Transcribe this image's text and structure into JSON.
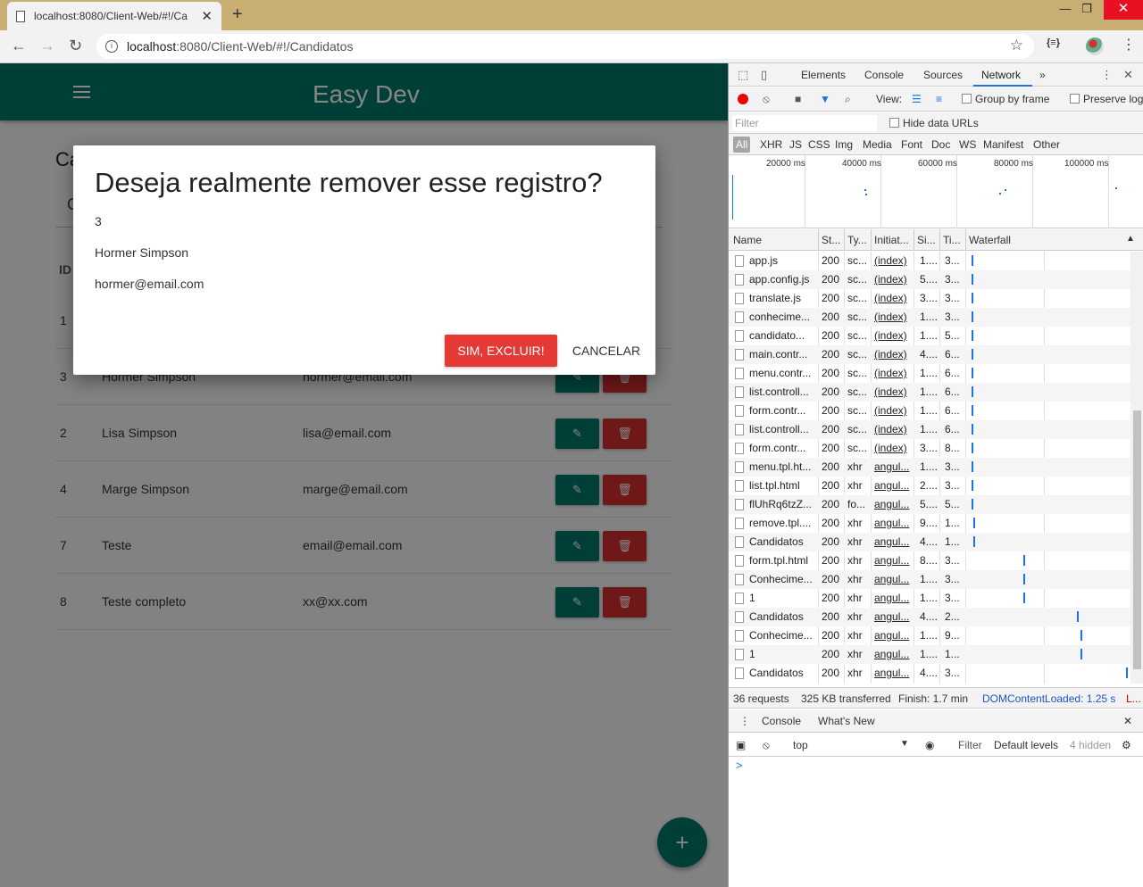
{
  "browser": {
    "tab_title": "localhost:8080/Client-Web/#!/Ca",
    "url_host": "localhost",
    "url_path": ":8080/Client-Web/#!/Candidatos",
    "new_tab": "+",
    "minimize": "—",
    "restore": "❐",
    "close": "✕",
    "ext_label": "{≡}"
  },
  "app": {
    "title": "Easy Dev",
    "page_title": "Ca",
    "search_label": "C",
    "col_id": "ID",
    "rows": [
      {
        "id": "1",
        "name": "",
        "email": ""
      },
      {
        "id": "3",
        "name": "Hormer Simpson",
        "email": "hormer@email.com"
      },
      {
        "id": "2",
        "name": "Lisa Simpson",
        "email": "lisa@email.com"
      },
      {
        "id": "4",
        "name": "Marge Simpson",
        "email": "marge@email.com"
      },
      {
        "id": "7",
        "name": "Teste",
        "email": "email@email.com"
      },
      {
        "id": "8",
        "name": "Teste completo",
        "email": "xx@xx.com"
      }
    ],
    "edit_icon": "✎",
    "delete_icon": "🗑",
    "fab": "+"
  },
  "dialog": {
    "title": "Deseja realmente remover esse registro?",
    "id": "3",
    "name": "Hormer Simpson",
    "email": "hormer@email.com",
    "confirm": "SIM, EXCLUIR!",
    "cancel": "CANCELAR"
  },
  "devtools": {
    "tabs": [
      "Elements",
      "Console",
      "Sources",
      "Network"
    ],
    "more": "»",
    "view_label": "View:",
    "group_by_frame": "Group by frame",
    "preserve_log": "Preserve log",
    "filter_placeholder": "Filter",
    "hide_data_urls": "Hide data URLs",
    "types": [
      "All",
      "XHR",
      "JS",
      "CSS",
      "Img",
      "Media",
      "Font",
      "Doc",
      "WS",
      "Manifest",
      "Other"
    ],
    "ticks": [
      "20000 ms",
      "40000 ms",
      "60000 ms",
      "80000 ms",
      "100000 ms"
    ],
    "columns": [
      "Name",
      "St...",
      "Ty...",
      "Initiat...",
      "Si...",
      "Ti...",
      "Waterfall"
    ],
    "rows": [
      {
        "name": "app.js",
        "status": "200",
        "type": "sc...",
        "initiator": "(index)",
        "size": "1....",
        "time": "3...",
        "wf": 0.01
      },
      {
        "name": "app.config.js",
        "status": "200",
        "type": "sc...",
        "initiator": "(index)",
        "size": "5....",
        "time": "3...",
        "wf": 0.01
      },
      {
        "name": "translate.js",
        "status": "200",
        "type": "sc...",
        "initiator": "(index)",
        "size": "3....",
        "time": "3...",
        "wf": 0.01
      },
      {
        "name": "conhecime...",
        "status": "200",
        "type": "sc...",
        "initiator": "(index)",
        "size": "1....",
        "time": "3...",
        "wf": 0.01
      },
      {
        "name": "candidato...",
        "status": "200",
        "type": "sc...",
        "initiator": "(index)",
        "size": "1....",
        "time": "5...",
        "wf": 0.01
      },
      {
        "name": "main.contr...",
        "status": "200",
        "type": "sc...",
        "initiator": "(index)",
        "size": "4....",
        "time": "6...",
        "wf": 0.01
      },
      {
        "name": "menu.contr...",
        "status": "200",
        "type": "sc...",
        "initiator": "(index)",
        "size": "1....",
        "time": "6...",
        "wf": 0.01
      },
      {
        "name": "list.controll...",
        "status": "200",
        "type": "sc...",
        "initiator": "(index)",
        "size": "1....",
        "time": "6...",
        "wf": 0.01
      },
      {
        "name": "form.contr...",
        "status": "200",
        "type": "sc...",
        "initiator": "(index)",
        "size": "1....",
        "time": "6...",
        "wf": 0.01
      },
      {
        "name": "list.controll...",
        "status": "200",
        "type": "sc...",
        "initiator": "(index)",
        "size": "1....",
        "time": "6...",
        "wf": 0.01
      },
      {
        "name": "form.contr...",
        "status": "200",
        "type": "sc...",
        "initiator": "(index)",
        "size": "3....",
        "time": "8...",
        "wf": 0.01
      },
      {
        "name": "menu.tpl.ht...",
        "status": "200",
        "type": "xhr",
        "initiator": "angul...",
        "size": "1....",
        "time": "3...",
        "wf": 0.01
      },
      {
        "name": "list.tpl.html",
        "status": "200",
        "type": "xhr",
        "initiator": "angul...",
        "size": "2....",
        "time": "3...",
        "wf": 0.01
      },
      {
        "name": "flUhRq6tzZ...",
        "status": "200",
        "type": "fo...",
        "initiator": "angul...",
        "size": "5....",
        "time": "5...",
        "wf": 0.01
      },
      {
        "name": "remove.tpl....",
        "status": "200",
        "type": "xhr",
        "initiator": "angul...",
        "size": "9....",
        "time": "1...",
        "wf": 0.02
      },
      {
        "name": "Candidatos",
        "status": "200",
        "type": "xhr",
        "initiator": "angul...",
        "size": "4....",
        "time": "1...",
        "wf": 0.02
      },
      {
        "name": "form.tpl.html",
        "status": "200",
        "type": "xhr",
        "initiator": "angul...",
        "size": "8....",
        "time": "3...",
        "wf": 0.34
      },
      {
        "name": "Conhecime...",
        "status": "200",
        "type": "xhr",
        "initiator": "angul...",
        "size": "1....",
        "time": "3...",
        "wf": 0.34
      },
      {
        "name": "1",
        "status": "200",
        "type": "xhr",
        "initiator": "angul...",
        "size": "1....",
        "time": "3...",
        "wf": 0.34
      },
      {
        "name": "Candidatos",
        "status": "200",
        "type": "xhr",
        "initiator": "angul...",
        "size": "4....",
        "time": "2...",
        "wf": 0.68
      },
      {
        "name": "Conhecime...",
        "status": "200",
        "type": "xhr",
        "initiator": "angul...",
        "size": "1....",
        "time": "9...",
        "wf": 0.7
      },
      {
        "name": "1",
        "status": "200",
        "type": "xhr",
        "initiator": "angul...",
        "size": "1....",
        "time": "1...",
        "wf": 0.7
      },
      {
        "name": "Candidatos",
        "status": "200",
        "type": "xhr",
        "initiator": "angul...",
        "size": "4....",
        "time": "3...",
        "wf": 0.99
      }
    ],
    "status_requests": "36 requests",
    "status_transferred": "325 KB transferred",
    "status_finish": "Finish: 1.7 min",
    "status_dcl": "DOMContentLoaded: 1.25 s",
    "status_load": "L...",
    "drawer_tabs": [
      "Console",
      "What's New"
    ],
    "console_context": "top",
    "console_filter": "Filter",
    "console_level": "Default levels",
    "console_hidden": "4 hidden",
    "prompt": ">",
    "colors": {
      "accent": "#1a73e8",
      "record": "#ee0000"
    }
  },
  "colors": {
    "primary": "#00796b",
    "danger": "#d32f2f",
    "confirm": "#e53935"
  }
}
